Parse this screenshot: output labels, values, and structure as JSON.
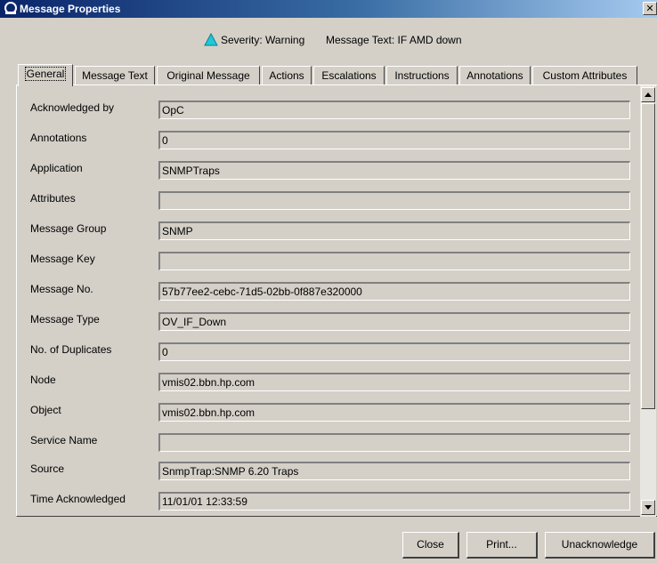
{
  "window": {
    "title": "Message Properties",
    "close_glyph": "✕",
    "icon": "hp-logo-icon"
  },
  "summary": {
    "severity_icon": "warning-triangle-icon",
    "severity_color": "#20c8d8",
    "severity": "Severity: Warning",
    "message_text": "Message Text: IF AMD down"
  },
  "tabs": [
    {
      "label": "General",
      "active": true
    },
    {
      "label": "Message Text"
    },
    {
      "label": "Original Message"
    },
    {
      "label": "Actions"
    },
    {
      "label": "Escalations"
    },
    {
      "label": "Instructions"
    },
    {
      "label": "Annotations"
    },
    {
      "label": "Custom Attributes"
    }
  ],
  "fields": [
    {
      "label": "Acknowledged by",
      "value": "OpC"
    },
    {
      "label": "Annotations",
      "value": "0"
    },
    {
      "label": "Application",
      "value": "SNMPTraps"
    },
    {
      "label": "Attributes",
      "value": ""
    },
    {
      "label": "Message Group",
      "value": "SNMP"
    },
    {
      "label": "Message Key",
      "value": ""
    },
    {
      "label": "Message No.",
      "value": "57b77ee2-cebc-71d5-02bb-0f887e320000"
    },
    {
      "label": "Message Type",
      "value": "OV_IF_Down"
    },
    {
      "label": "No. of Duplicates",
      "value": "0"
    },
    {
      "label": "Node",
      "value": "vmis02.bbn.hp.com"
    },
    {
      "label": "Object",
      "value": "vmis02.bbn.hp.com"
    },
    {
      "label": "Service Name",
      "value": ""
    },
    {
      "label": "Source",
      "value": "SnmpTrap:SNMP 6.20 Traps"
    },
    {
      "label": "Time Acknowledged",
      "value": "11/01/01 12:33:59"
    }
  ],
  "buttons": {
    "close": "Close",
    "print": "Print...",
    "unacknowledge": "Unacknowledge"
  }
}
